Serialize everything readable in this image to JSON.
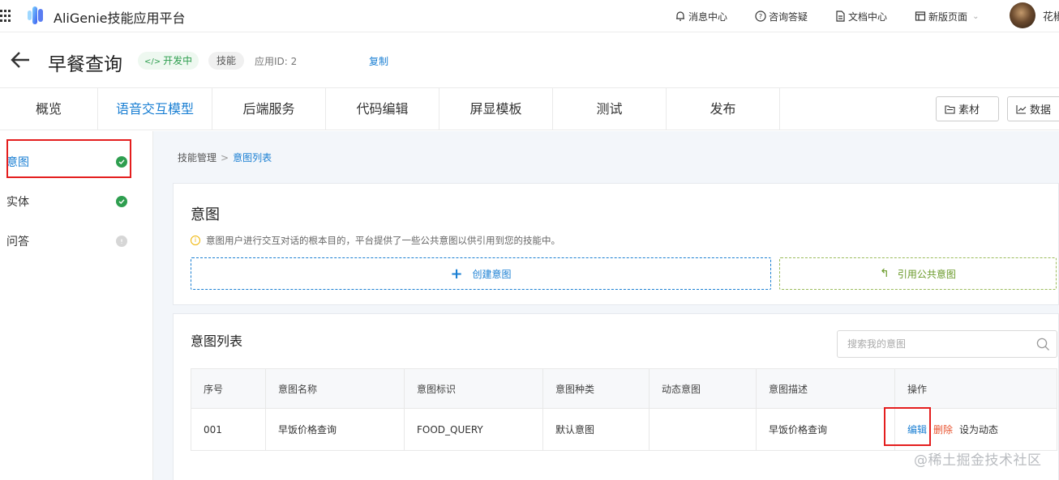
{
  "topbar": {
    "app_title": "AliGenie技能应用平台",
    "links": [
      {
        "label": "消息中心",
        "icon": "bell-icon"
      },
      {
        "label": "咨询答疑",
        "icon": "help-circle-icon"
      },
      {
        "label": "文档中心",
        "icon": "document-icon"
      },
      {
        "label": "新版页面",
        "icon": "window-icon"
      }
    ],
    "user_name": "花椒"
  },
  "header": {
    "skill_name": "早餐查询",
    "status": "开发中",
    "type": "技能",
    "app_id_label": "应用ID: 2",
    "copy_label": "复制"
  },
  "tabs": [
    {
      "label": "概览",
      "active": false
    },
    {
      "label": "语音交互模型",
      "active": true
    },
    {
      "label": "后端服务",
      "active": false
    },
    {
      "label": "代码编辑",
      "active": false
    },
    {
      "label": "屏显模板",
      "active": false
    },
    {
      "label": "测试",
      "active": false
    },
    {
      "label": "发布",
      "active": false
    }
  ],
  "tab_buttons": {
    "material": "素材",
    "data": "数据"
  },
  "sidebar": {
    "items": [
      {
        "label": "意图",
        "status": "done",
        "active": true
      },
      {
        "label": "实体",
        "status": "done",
        "active": false
      },
      {
        "label": "问答",
        "status": "pending",
        "active": false
      }
    ]
  },
  "breadcrumb": {
    "parent": "技能管理",
    "separator": ">",
    "current": "意图列表"
  },
  "intent_card": {
    "title": "意图",
    "hint": "意图用户进行交互对话的根本目的，平台提供了一些公共意图以供引用到您的技能中。",
    "create_label": "创建意图",
    "reference_label": "引用公共意图"
  },
  "intent_list": {
    "title": "意图列表",
    "search_placeholder": "搜索我的意图",
    "columns": [
      "序号",
      "意图名称",
      "意图标识",
      "意图种类",
      "动态意图",
      "意图描述",
      "操作"
    ],
    "rows": [
      {
        "index": "001",
        "name": "早饭价格查询",
        "identifier": "FOOD_QUERY",
        "kind": "默认意图",
        "dynamic": "",
        "description": "早饭价格查询",
        "actions": {
          "edit": "编辑",
          "delete": "删除",
          "dynamic": "设为动态"
        }
      }
    ]
  },
  "watermark": "@稀土掘金技术社区",
  "colors": {
    "accent": "#1a7fd3",
    "success": "#2e9e4f",
    "danger": "#e8532f",
    "highlight_box": "#e41e1e"
  }
}
